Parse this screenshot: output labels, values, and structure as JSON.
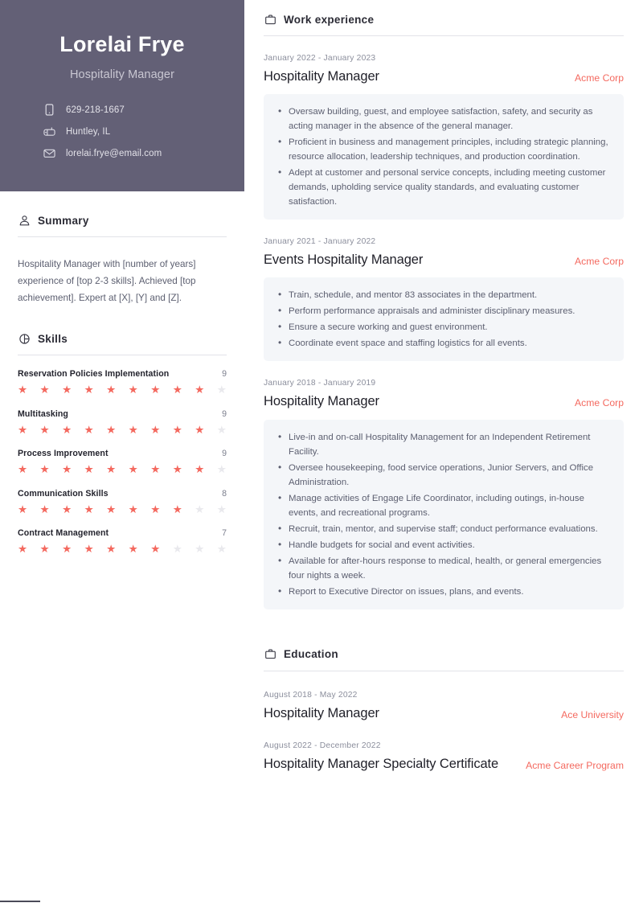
{
  "profile": {
    "name": "Lorelai Frye",
    "title": "Hospitality Manager",
    "contacts": [
      {
        "icon": "phone-icon",
        "value": "629-218-1667"
      },
      {
        "icon": "location-icon",
        "value": "Huntley, IL"
      },
      {
        "icon": "email-icon",
        "value": "lorelai.frye@email.com"
      }
    ]
  },
  "summary": {
    "heading": "Summary",
    "icon": "person-icon",
    "text": "Hospitality Manager with [number of years] experience of [top 2-3 skills]. Achieved [top achievement]. Expert at [X], [Y] and [Z]."
  },
  "skills": {
    "heading": "Skills",
    "icon": "pie-chart-icon",
    "max": 10,
    "items": [
      {
        "name": "Reservation Policies Implementation",
        "score": 9
      },
      {
        "name": "Multitasking",
        "score": 9
      },
      {
        "name": "Process Improvement",
        "score": 9
      },
      {
        "name": "Communication Skills",
        "score": 8
      },
      {
        "name": "Contract Management",
        "score": 7
      }
    ]
  },
  "work": {
    "heading": "Work experience",
    "icon": "briefcase-icon",
    "entries": [
      {
        "dates": "January 2022 - January 2023",
        "role": "Hospitality Manager",
        "org": "Acme Corp",
        "bullets": [
          "Oversaw building, guest, and employee satisfaction, safety, and security as acting manager in the absence of the general manager.",
          "Proficient in business and management principles, including strategic planning, resource allocation, leadership techniques, and production coordination.",
          "Adept at customer and personal service concepts, including meeting customer demands, upholding service quality standards, and evaluating customer satisfaction."
        ]
      },
      {
        "dates": "January 2021 - January 2022",
        "role": "Events Hospitality Manager",
        "org": "Acme Corp",
        "bullets": [
          "Train, schedule, and mentor 83 associates in the department.",
          "Perform performance appraisals and administer disciplinary measures.",
          "Ensure a secure working and guest environment.",
          "Coordinate event space and staffing logistics for all events."
        ]
      },
      {
        "dates": "January 2018 - January 2019",
        "role": "Hospitality Manager",
        "org": "Acme Corp",
        "bullets": [
          "Live-in and on-call Hospitality Management for an Independent Retirement Facility.",
          "Oversee housekeeping, food service operations, Junior Servers, and Office Administration.",
          "Manage activities of Engage Life Coordinator, including outings, in-house events, and recreational programs.",
          "Recruit, train, mentor, and supervise staff; conduct performance evaluations.",
          "Handle budgets for social and event activities.",
          "Available for after-hours response to medical, health, or general emergencies four nights a week.",
          "Report to Executive Director on issues, plans, and events."
        ]
      }
    ]
  },
  "education": {
    "heading": "Education",
    "icon": "briefcase-icon",
    "entries": [
      {
        "dates": "August 2018 - May 2022",
        "role": "Hospitality Manager",
        "org": "Ace University"
      },
      {
        "dates": "August 2022 - December 2022",
        "role": "Hospitality Manager Specialty Certificate",
        "org": "Acme Career Program"
      }
    ]
  },
  "theme": {
    "accent": "#f4695f",
    "header_bg": "#636076",
    "card_bg": "#f4f6f9"
  }
}
